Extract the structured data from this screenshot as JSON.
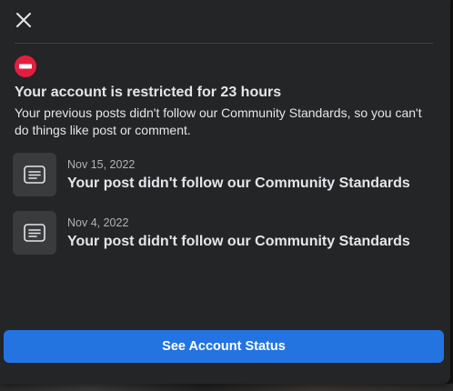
{
  "dialog": {
    "close_icon": "close-icon",
    "restriction_icon": "no-entry-icon",
    "title": "Your account is restricted for 23 hours",
    "description": "Your previous posts didn't follow our Community Standards, so you can't do things like post or comment.",
    "violations": [
      {
        "icon": "document-icon",
        "date": "Nov 15, 2022",
        "title": "Your post didn't follow our Community Standards"
      },
      {
        "icon": "document-icon",
        "date": "Nov 4, 2022",
        "title": "Your post didn't follow our Community Standards"
      }
    ],
    "primary_button": "See Account Status"
  },
  "colors": {
    "dialog_background": "#242526",
    "primary_text": "#e4e6eb",
    "secondary_text": "#b0b3b8",
    "item_icon_background": "#3a3b3c",
    "restriction_red": "#e41e3f",
    "primary_button": "#2374e1"
  }
}
